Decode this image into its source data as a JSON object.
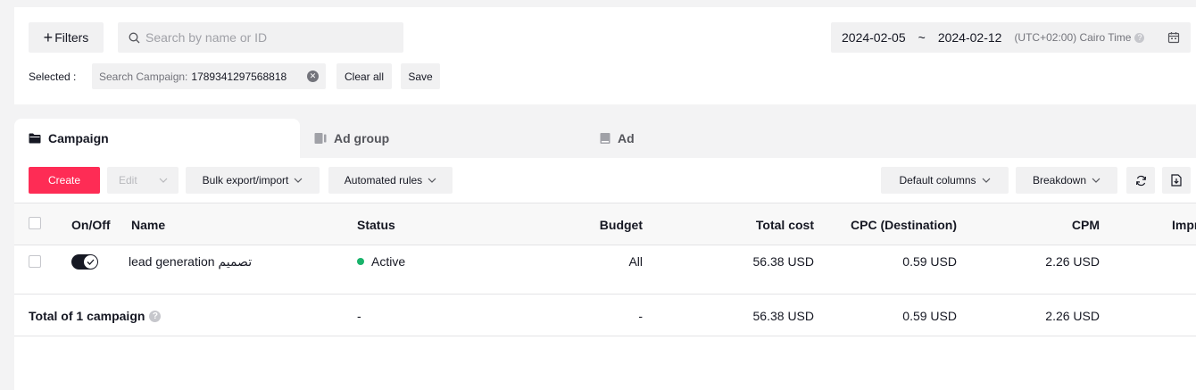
{
  "filters": {
    "filters_label": "Filters",
    "search_placeholder": "Search by name or ID",
    "date_start": "2024-02-05",
    "date_separator": "~",
    "date_end": "2024-02-12",
    "timezone": "(UTC+02:00) Cairo Time",
    "selected_label": "Selected :",
    "chip_key": "Search Campaign:",
    "chip_value": "1789341297568818",
    "clear_all": "Clear all",
    "save": "Save"
  },
  "tabs": [
    {
      "label": "Campaign",
      "active": true
    },
    {
      "label": "Ad group",
      "active": false
    },
    {
      "label": "Ad",
      "active": false
    }
  ],
  "toolbar": {
    "create": "Create",
    "edit": "Edit",
    "bulk": "Bulk export/import",
    "automated": "Automated rules",
    "default_columns": "Default columns",
    "breakdown": "Breakdown"
  },
  "table": {
    "columns": [
      "On/Off",
      "Name",
      "Status",
      "Budget",
      "Total cost",
      "CPC (Destination)",
      "CPM",
      "Impr"
    ],
    "rows": [
      {
        "toggle_on": true,
        "name": "lead generation تصميم",
        "status": "Active",
        "budget": "All",
        "total_cost": "56.38 USD",
        "cpc": "0.59 USD",
        "cpm": "2.26 USD"
      }
    ],
    "total": {
      "label": "Total of 1 campaign",
      "status": "-",
      "budget": "-",
      "total_cost": "56.38 USD",
      "cpc": "0.59 USD",
      "cpm": "2.26 USD"
    }
  },
  "colors": {
    "accent": "#fe2c55",
    "status_active": "#19b36b"
  }
}
